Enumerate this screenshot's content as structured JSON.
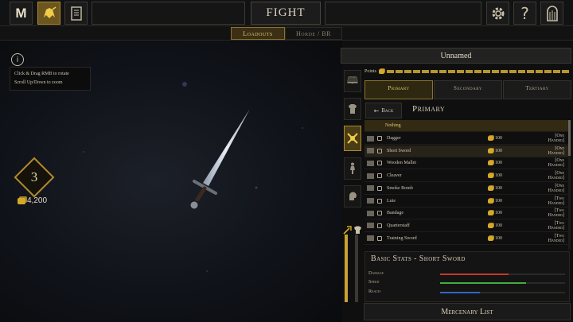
{
  "topbar": {
    "logo": "M",
    "fight_label": "FIGHT",
    "icons": [
      "logo-m-icon",
      "helmet-icon",
      "scroll-icon",
      "gear-icon",
      "help-icon",
      "exit-door-icon"
    ],
    "help_glyph": "?"
  },
  "subtabs": [
    {
      "label": "Loadouts",
      "active": true
    },
    {
      "label": "Horde / BR",
      "active": false
    }
  ],
  "viewport": {
    "info_glyph": "i",
    "hint_line1": "Click & Drag RMB to rotate",
    "hint_line2": "Scroll Up/Down to zoom",
    "level": "3",
    "gold": "4,200"
  },
  "loadout": {
    "name": "Unnamed",
    "points_label": "Points",
    "points_fraction": 1.0,
    "weapon_tabs": [
      {
        "label": "Primary",
        "active": true
      },
      {
        "label": "Secondary",
        "active": false
      },
      {
        "label": "Tertiary",
        "active": false
      }
    ],
    "back_label": "Back",
    "list_title": "Primary",
    "nothing_label": "Nothing",
    "items": [
      {
        "name": "Dagger",
        "cost": "100",
        "hand": "[One Handed]",
        "selected": false
      },
      {
        "name": "Short Sword",
        "cost": "100",
        "hand": "[One Handed]",
        "selected": true
      },
      {
        "name": "Wooden Mallet",
        "cost": "100",
        "hand": "[One Handed]",
        "selected": false
      },
      {
        "name": "Cleaver",
        "cost": "100",
        "hand": "[One Handed]",
        "selected": false
      },
      {
        "name": "Smoke Bomb",
        "cost": "100",
        "hand": "[One Handed]",
        "selected": false
      },
      {
        "name": "Lute",
        "cost": "100",
        "hand": "[Two Handed]",
        "selected": false
      },
      {
        "name": "Bandage",
        "cost": "100",
        "hand": "[Two Handed]",
        "selected": false
      },
      {
        "name": "Quarterstaff",
        "cost": "100",
        "hand": "[Two Handed]",
        "selected": false
      },
      {
        "name": "Training Sword",
        "cost": "100",
        "hand": "[Two Handed]",
        "selected": false
      }
    ],
    "stats_title": "Basic Stats - Short Sword",
    "stats": [
      {
        "label": "Damage",
        "value": 0.55,
        "color": "#c23a2a"
      },
      {
        "label": "Speed",
        "value": 0.69,
        "color": "#3fae3a"
      },
      {
        "label": "Reach",
        "value": 0.32,
        "color": "#3266c8"
      }
    ],
    "mercenary_label": "Mercenary List"
  },
  "colors": {
    "accent_gold": "#c9a232",
    "panel_bg": "#0f0f10"
  }
}
